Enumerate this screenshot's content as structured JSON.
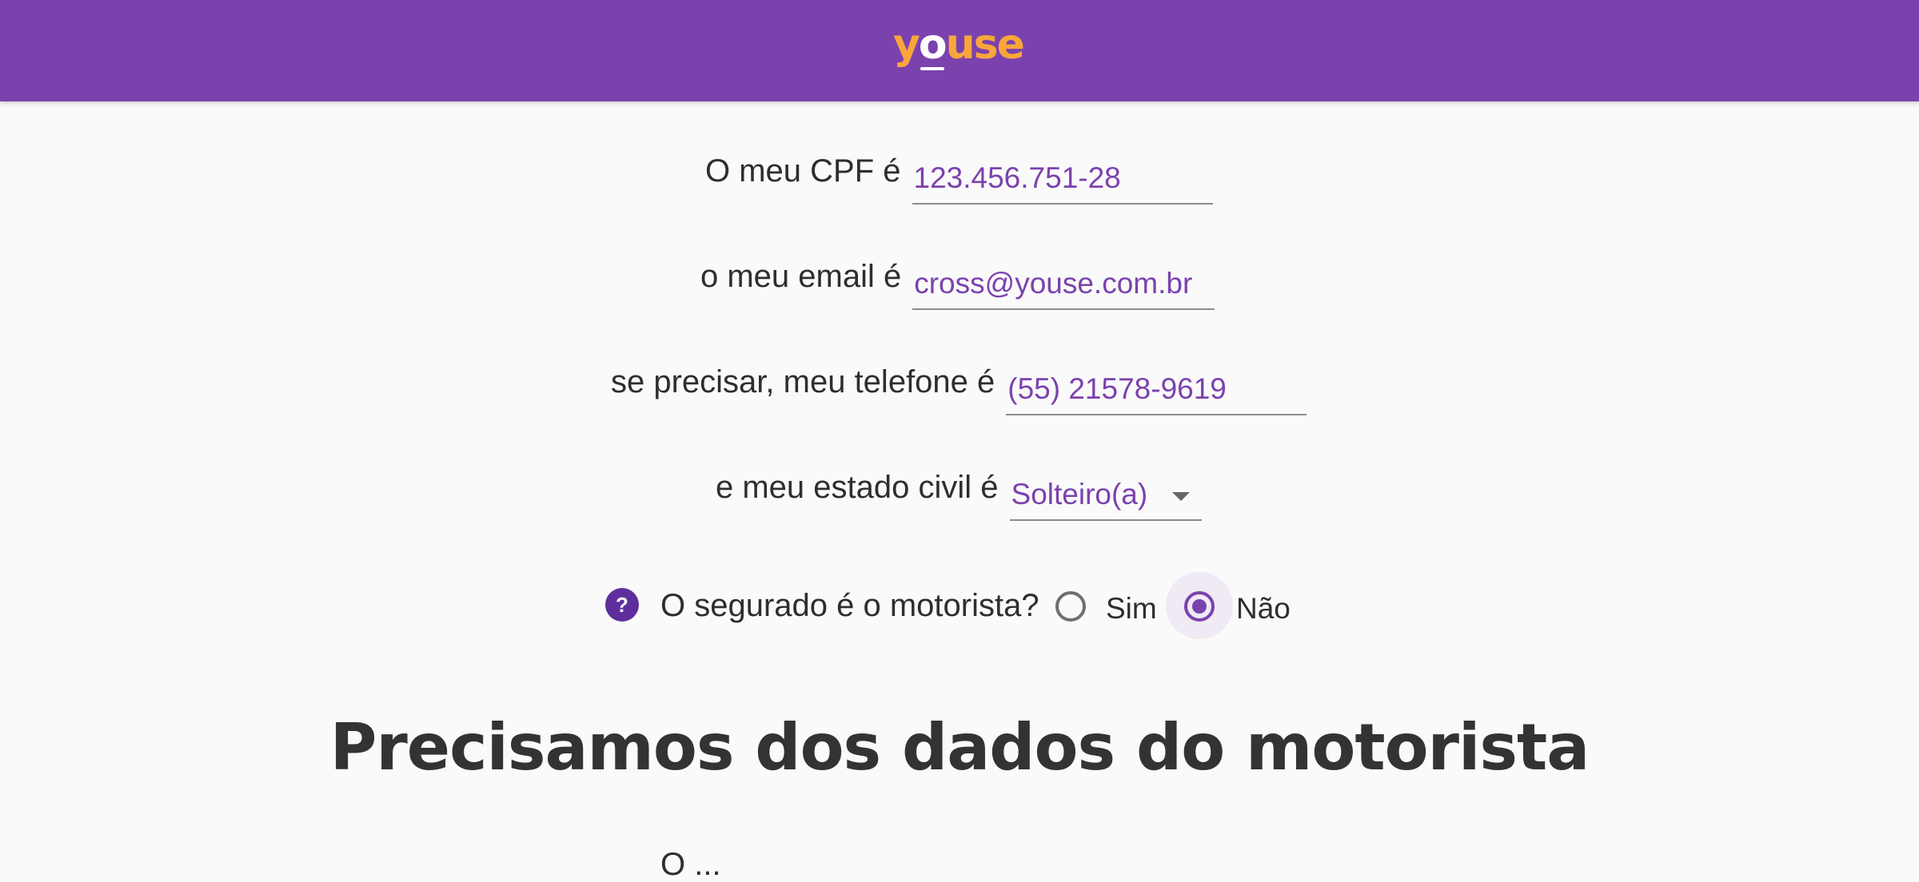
{
  "header": {
    "logo": "youse",
    "brand_color": "#7b42ae",
    "logo_color": "#f8a63b"
  },
  "form": {
    "cpf": {
      "label": "O meu CPF é",
      "value": "123.456.751-28"
    },
    "email": {
      "label": "o meu email é",
      "value": "cross@youse.com.br"
    },
    "phone": {
      "label": "se precisar, meu telefone é",
      "value": "(55) 21578-9619"
    },
    "marital_status": {
      "label": "e meu estado civil é",
      "selected": "Solteiro(a)"
    },
    "insured_is_driver": {
      "help_icon": "question-mark-icon",
      "help_glyph": "?",
      "question": "O segurado é o motorista?",
      "options": [
        "Sim",
        "Não"
      ],
      "selected": "Não"
    }
  },
  "section": {
    "heading": "Precisamos dos dados do motorista",
    "next_label_partial": "O ..."
  }
}
